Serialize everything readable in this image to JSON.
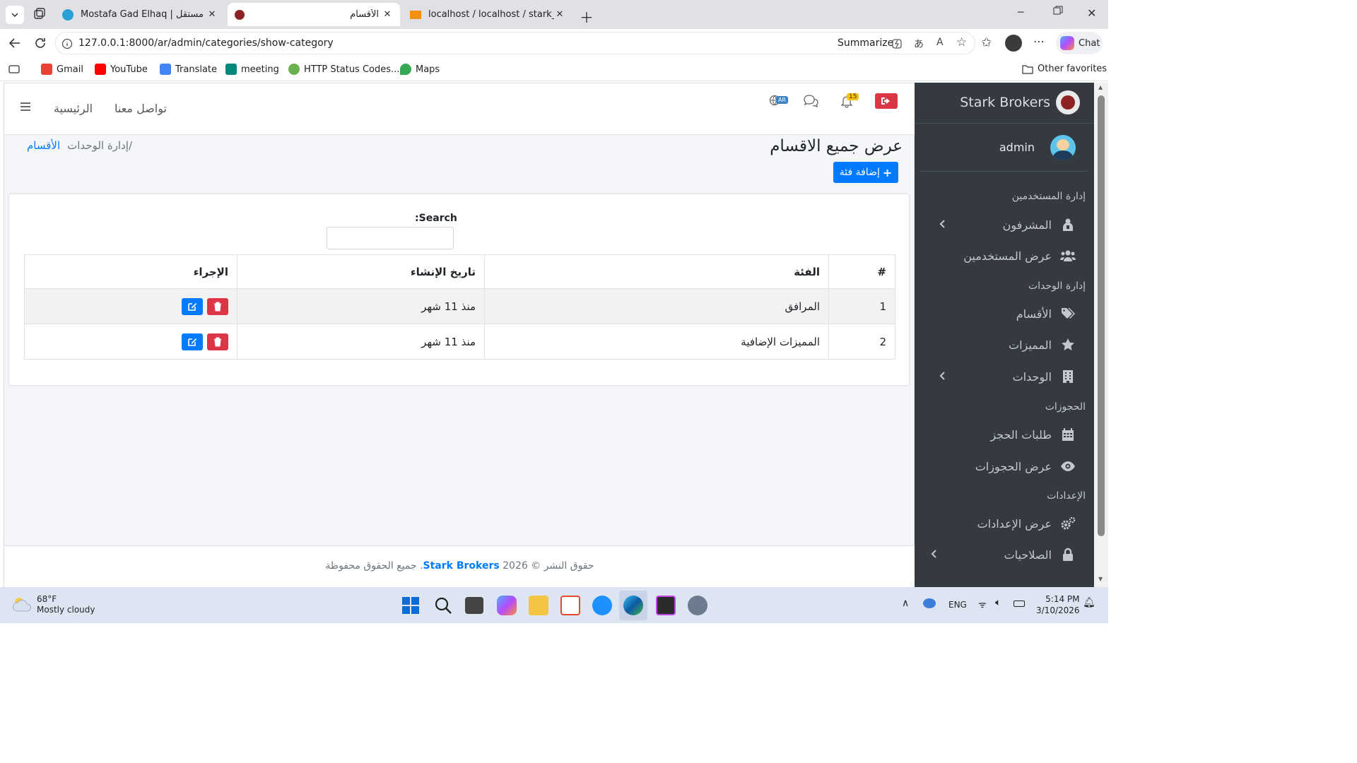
{
  "browser": {
    "tabs": [
      {
        "title": "Mostafa Gad Elhaq | مستقل"
      },
      {
        "title": "الأقسام"
      },
      {
        "title": "localhost / localhost / stark_broker"
      }
    ],
    "url": "127.0.0.1:8000/ar/admin/categories/show-category",
    "summarize_label": "Summarize",
    "chat_label": "Chat",
    "bookmarks": [
      {
        "label": "Gmail",
        "icon": "gmail-icon",
        "color": "#ea4335"
      },
      {
        "label": "YouTube",
        "icon": "youtube-icon",
        "color": "#ff0000"
      },
      {
        "label": "Translate",
        "icon": "translate-icon",
        "color": "#4285f4"
      },
      {
        "label": "meeting",
        "icon": "meet-icon",
        "color": "#00897b"
      },
      {
        "label": "HTTP Status Codes...",
        "icon": "http-icon",
        "color": "#6ab04c"
      },
      {
        "label": "Maps",
        "icon": "maps-icon",
        "color": "#34a853"
      }
    ],
    "other_favorites": "Other favorites"
  },
  "topnav": {
    "links": [
      "تواصل معنا",
      "الرئيسية"
    ],
    "lang_badge": "AR",
    "notif_count": "15"
  },
  "header": {
    "title": "عرض جميع الاقسام",
    "breadcrumb_active": "الأقسام",
    "breadcrumb_parent": "/إدارة الوحدات",
    "add_button": "إضافة فئة"
  },
  "table": {
    "search_label": "Search:",
    "columns": [
      "#",
      "الفئة",
      "تاريخ الإنشاء",
      "الإجراء"
    ],
    "rows": [
      {
        "num": "1",
        "category": "المرافق",
        "created": "منذ 11 شهر"
      },
      {
        "num": "2",
        "category": "المميزات الإضافية",
        "created": "منذ 11 شهر"
      }
    ]
  },
  "footer": {
    "prefix": "حقوق النشر © 2026",
    "brand": "Stark Brokers",
    "suffix": ". جميع الحقوق محفوظة"
  },
  "sidebar": {
    "brand": "Stark Brokers",
    "user": "admin",
    "sections": [
      {
        "header": "إدارة المستخدمين",
        "items": [
          {
            "label": "المشرفون",
            "icon": "user-shield-icon",
            "has_children": true
          },
          {
            "label": "عرض المستخدمين",
            "icon": "users-icon",
            "has_children": false
          }
        ]
      },
      {
        "header": "إدارة الوحدات",
        "items": [
          {
            "label": "الأقسام",
            "icon": "tags-icon",
            "has_children": false
          },
          {
            "label": "المميزات",
            "icon": "star-icon",
            "has_children": false
          },
          {
            "label": "الوحدات",
            "icon": "building-icon",
            "has_children": true
          }
        ]
      },
      {
        "header": "الحجوزات",
        "items": [
          {
            "label": "طلبات الحجز",
            "icon": "calendar-icon",
            "has_children": false
          },
          {
            "label": "عرض الحجوزات",
            "icon": "eye-icon",
            "has_children": false
          }
        ]
      },
      {
        "header": "الإعدادات",
        "items": [
          {
            "label": "عرض الإعدادات",
            "icon": "cogs-icon",
            "has_children": false
          },
          {
            "label": "الصلاحيات",
            "icon": "lock-icon",
            "has_children": true
          }
        ]
      }
    ]
  },
  "taskbar": {
    "weather_temp": "68°F",
    "weather_desc": "Mostly cloudy",
    "lang": "ENG",
    "time": "5:14 PM",
    "date": "3/10/2026"
  },
  "colors": {
    "primary": "#007bff",
    "danger": "#dc3545",
    "sidebar_bg": "#343a40",
    "notif_badge": "#ffc107"
  }
}
